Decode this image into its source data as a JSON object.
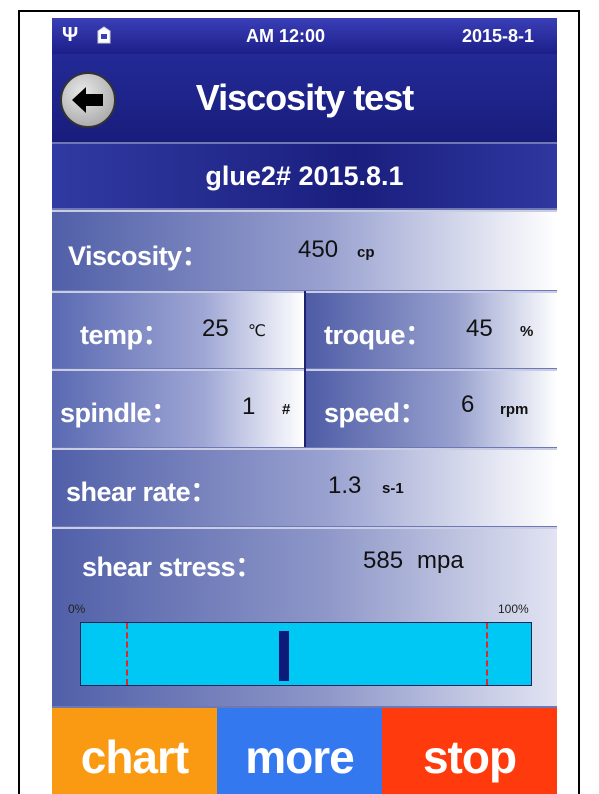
{
  "status_bar": {
    "time": "AM 12:00",
    "date": "2015-8-1",
    "usb_icon": "usb-icon",
    "device_icon": "storage-icon"
  },
  "header": {
    "title": "Viscosity test",
    "back_icon": "arrow-left-icon"
  },
  "sample": {
    "name": "glue2# 2015.8.1"
  },
  "viscosity": {
    "label": "Viscosity：",
    "value": "450",
    "unit": "cp"
  },
  "temp": {
    "label": "temp：",
    "value": "25",
    "unit": "℃"
  },
  "troque": {
    "label": "troque：",
    "value": "45",
    "unit": "%"
  },
  "spindle": {
    "label": "spindle：",
    "value": "1",
    "unit": "#"
  },
  "speed": {
    "label": "speed：",
    "value": "6",
    "unit": "rpm"
  },
  "shear_rate": {
    "label": "shear rate：",
    "value": "1.3",
    "unit": "s-1"
  },
  "shear_stress": {
    "label": "shear stress：",
    "value": "585",
    "unit": "mpa"
  },
  "gauge": {
    "min_label": "0%",
    "max_label": "100%",
    "low_limit_pct": 10,
    "high_limit_pct": 90,
    "current_pct": 45
  },
  "buttons": {
    "chart": "chart",
    "more": "more",
    "stop": "stop"
  },
  "colors": {
    "chart_button": "#f99a12",
    "more_button": "#3478f0",
    "stop_button": "#ff3a0c",
    "gauge_fill": "#00c8f4",
    "limit_line": "#e0282a",
    "needle": "#0d1a78"
  }
}
